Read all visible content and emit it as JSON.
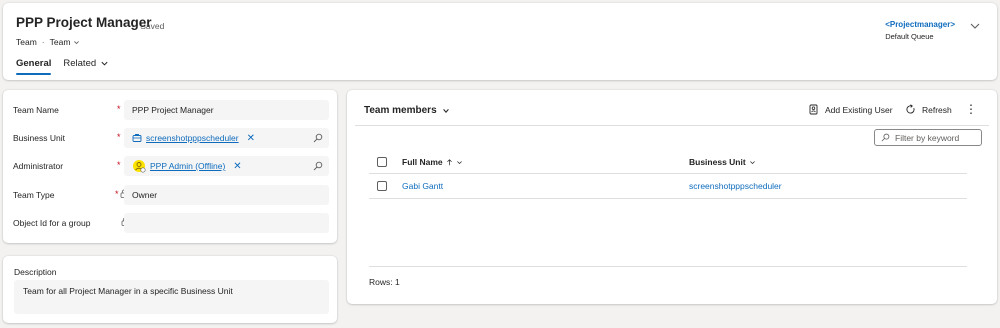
{
  "header": {
    "title": "PPP Project Manager",
    "saved": "- Saved",
    "breadcrumb_entity": "Team",
    "breadcrumb_separator": "·",
    "breadcrumb_form": "Team",
    "owner_name": "<Projectmanager>",
    "owner_queue": "Default Queue",
    "tabs": [
      {
        "label": "General",
        "active": true
      },
      {
        "label": "Related",
        "active": false
      }
    ]
  },
  "form": {
    "fields": [
      {
        "label": "Team Name",
        "required": "*",
        "value": "PPP Project Manager"
      },
      {
        "label": "Business Unit",
        "required": "*",
        "value": "screenshotpppscheduler",
        "icon": "business-unit-icon"
      },
      {
        "label": "Administrator",
        "required": "*",
        "value": "PPP Admin (Offline)",
        "icon": "user-avatar-icon"
      },
      {
        "label": "Team Type",
        "required": "*",
        "value": "Owner",
        "locked": true
      },
      {
        "label": "Object Id for a group",
        "value": "",
        "locked": true
      }
    ],
    "description_label": "Description",
    "description_value": "Team for all Project Manager in a specific Business Unit"
  },
  "team_members": {
    "title": "Team members",
    "add_existing_label": "Add Existing User",
    "refresh_label": "Refresh",
    "more_label": "⋮",
    "filter_placeholder": "Filter by keyword",
    "columns": [
      "Full Name",
      "Business Unit"
    ],
    "rows": [
      {
        "full_name": "Gabi Gantt",
        "business_unit": "screenshotpppscheduler"
      }
    ],
    "rows_label": "Rows: 1"
  },
  "colors": {
    "accent": "#0f6cbd",
    "required": "#c50f1f",
    "field_bg": "#f5f5f5",
    "page_bg": "#f3f2f1"
  }
}
